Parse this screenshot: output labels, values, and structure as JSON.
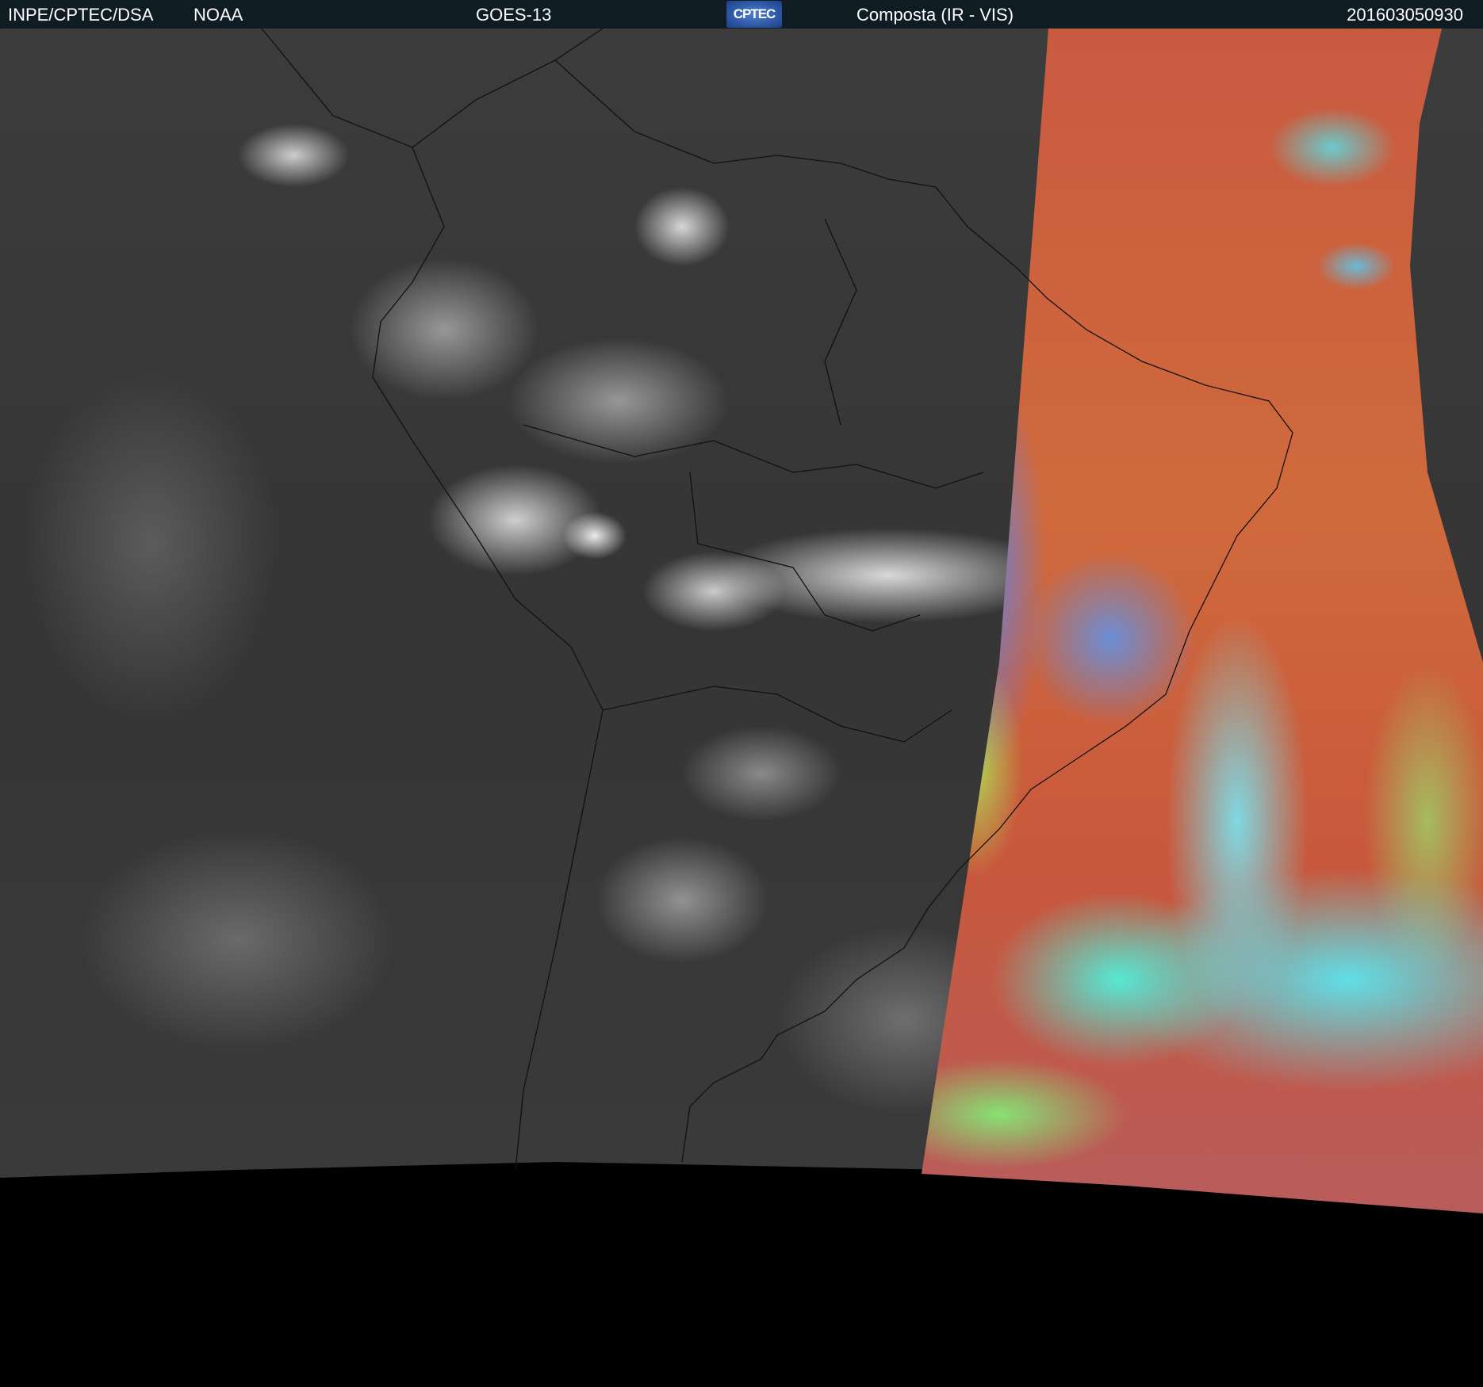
{
  "header": {
    "agency": "INPE/CPTEC/DSA",
    "source": "NOAA",
    "satellite": "GOES-13",
    "logo_text": "CPTEC",
    "product": "Composta (IR - VIS)",
    "timestamp": "201603050930"
  },
  "colors": {
    "header_bg": "#101c24",
    "text": "#ffffff"
  }
}
